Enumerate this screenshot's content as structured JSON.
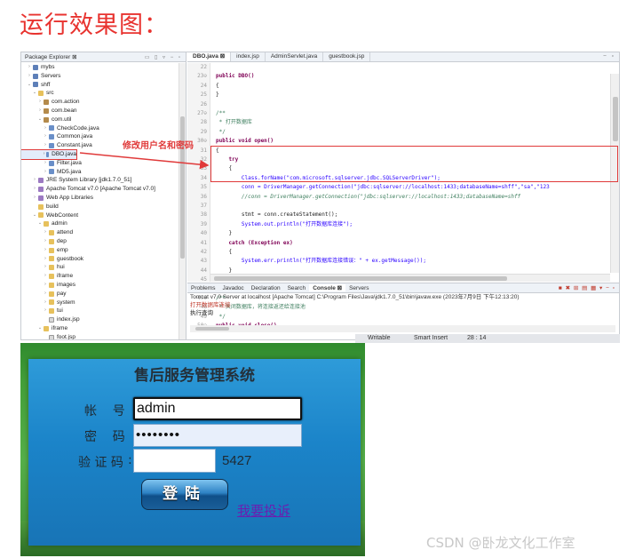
{
  "heading": "运行效果图：",
  "eclipse": {
    "package_explorer": {
      "tab_label": "Package Explorer ⊠",
      "tree": [
        {
          "label": "mybs",
          "icon": "project-icon",
          "arrow": "›"
        },
        {
          "label": "Servers",
          "icon": "project-icon",
          "arrow": "›"
        },
        {
          "label": "shff",
          "icon": "project-icon",
          "arrow": "⌄"
        },
        {
          "label": "src",
          "icon": "folder-icon",
          "arrow": "⌄"
        },
        {
          "label": "com.action",
          "icon": "package-icon",
          "arrow": "›"
        },
        {
          "label": "com.bean",
          "icon": "package-icon",
          "arrow": "›"
        },
        {
          "label": "com.util",
          "icon": "package-icon",
          "arrow": "⌄"
        },
        {
          "label": "CheckCode.java",
          "icon": "java-file-icon",
          "arrow": "›"
        },
        {
          "label": "Common.java",
          "icon": "java-file-icon",
          "arrow": "›"
        },
        {
          "label": "Constant.java",
          "icon": "java-file-icon",
          "arrow": "›"
        },
        {
          "label": "DBO.java",
          "icon": "java-file-icon",
          "arrow": "›"
        },
        {
          "label": "Filter.java",
          "icon": "java-file-icon",
          "arrow": "›"
        },
        {
          "label": "MD5.java",
          "icon": "java-file-icon",
          "arrow": "›"
        },
        {
          "label": "JRE System Library [jdk1.7.0_51]",
          "icon": "library-icon",
          "arrow": "›"
        },
        {
          "label": "Apache Tomcat v7.0 [Apache Tomcat v7.0]",
          "icon": "library-icon",
          "arrow": "›"
        },
        {
          "label": "Web App Libraries",
          "icon": "library-icon",
          "arrow": "›"
        },
        {
          "label": "build",
          "icon": "folder-icon",
          "arrow": ""
        },
        {
          "label": "WebContent",
          "icon": "folder-icon",
          "arrow": "⌄"
        },
        {
          "label": "admin",
          "icon": "folder-icon",
          "arrow": "⌄"
        },
        {
          "label": "attend",
          "icon": "folder-icon",
          "arrow": "›"
        },
        {
          "label": "dep",
          "icon": "folder-icon",
          "arrow": "›"
        },
        {
          "label": "emp",
          "icon": "folder-icon",
          "arrow": "›"
        },
        {
          "label": "guestbook",
          "icon": "folder-icon",
          "arrow": "›"
        },
        {
          "label": "hui",
          "icon": "folder-icon",
          "arrow": "›"
        },
        {
          "label": "iframe",
          "icon": "folder-icon",
          "arrow": "›"
        },
        {
          "label": "images",
          "icon": "folder-icon",
          "arrow": "›"
        },
        {
          "label": "pay",
          "icon": "folder-icon",
          "arrow": "›"
        },
        {
          "label": "system",
          "icon": "folder-icon",
          "arrow": "›"
        },
        {
          "label": "tui",
          "icon": "folder-icon",
          "arrow": "›"
        },
        {
          "label": "index.jsp",
          "icon": "file-icon",
          "arrow": ""
        },
        {
          "label": "iframe",
          "icon": "folder-icon",
          "arrow": "⌄"
        },
        {
          "label": "foot.jsp",
          "icon": "file-icon",
          "arrow": ""
        }
      ],
      "selected_label": "DBO.java"
    },
    "editor": {
      "tabs": [
        "DBO.java ⊠",
        "index.jsp",
        "AdminServlet.java",
        "guestbook.jsp"
      ],
      "lines": [
        {
          "n": "22",
          "text": ""
        },
        {
          "n": "23⊖",
          "text": "public DBO()"
        },
        {
          "n": "24",
          "text": "{"
        },
        {
          "n": "25",
          "text": "}"
        },
        {
          "n": "26",
          "text": ""
        },
        {
          "n": "27⊖",
          "text": "/**"
        },
        {
          "n": "28",
          "text": " * 打开数据库"
        },
        {
          "n": "29",
          "text": " */"
        },
        {
          "n": "30⊖",
          "text": "public void open()"
        },
        {
          "n": "31",
          "text": "{"
        },
        {
          "n": "32",
          "text": "    try"
        },
        {
          "n": "33",
          "text": "    {"
        },
        {
          "n": "34",
          "text": "        Class.forName(\"com.microsoft.sqlserver.jdbc.SQLServerDriver\");"
        },
        {
          "n": "35",
          "text": "        conn = DriverManager.getConnection(\"jdbc:sqlserver://localhost:1433;databaseName=shff\",\"sa\",\"123"
        },
        {
          "n": "36",
          "text": "        //conn = DriverManager.getConnection(\"jdbc:sqlserver://localhost:1433;databaseName=shff"
        },
        {
          "n": "37",
          "text": ""
        },
        {
          "n": "38",
          "text": "        stmt = conn.createStatement();"
        },
        {
          "n": "39",
          "text": "        System.out.println(\"打开数据库连接\");"
        },
        {
          "n": "40",
          "text": "    }"
        },
        {
          "n": "41",
          "text": "    catch (Exception ex)"
        },
        {
          "n": "42",
          "text": "    {"
        },
        {
          "n": "43",
          "text": "        System.err.println(\"打开数据库连接错误：\" + ex.getMessage());"
        },
        {
          "n": "44",
          "text": "    }"
        },
        {
          "n": "45",
          "text": "}"
        },
        {
          "n": "46",
          "text": ""
        },
        {
          "n": "47⊖",
          "text": "/**"
        },
        {
          "n": "48",
          "text": " * 关闭数据库，将连接返还给连接池"
        },
        {
          "n": "49",
          "text": " */"
        },
        {
          "n": "50⊖",
          "text": "public void close()"
        }
      ]
    },
    "console": {
      "tabs": [
        "Problems",
        "Javadoc",
        "Declaration",
        "Search",
        "Console ⊠",
        "Servers"
      ],
      "header": "Tomcat v7.0 Server at localhost [Apache Tomcat] C:\\Program Files\\Java\\jdk1.7.0_51\\bin\\javaw.exe (2023年7月9日 下午12:13:20)",
      "lines": [
        "打开数据库连接",
        "执行查询"
      ]
    },
    "status": {
      "mode": "Writable",
      "insert": "Smart Insert",
      "position": "28 : 14"
    },
    "annotation": "修改用户名和密码"
  },
  "login": {
    "title": "售后服务管理系统",
    "account_label": "帐    号",
    "account_value": "admin",
    "password_label": "密    码",
    "password_value": "••••••••",
    "captcha_label": "验 证 码",
    "captcha_value": "",
    "captcha_code": "5427",
    "login_button": "登陆",
    "complaint_link": "我要投诉"
  },
  "watermark": "CSDN @卧龙文化工作室"
}
